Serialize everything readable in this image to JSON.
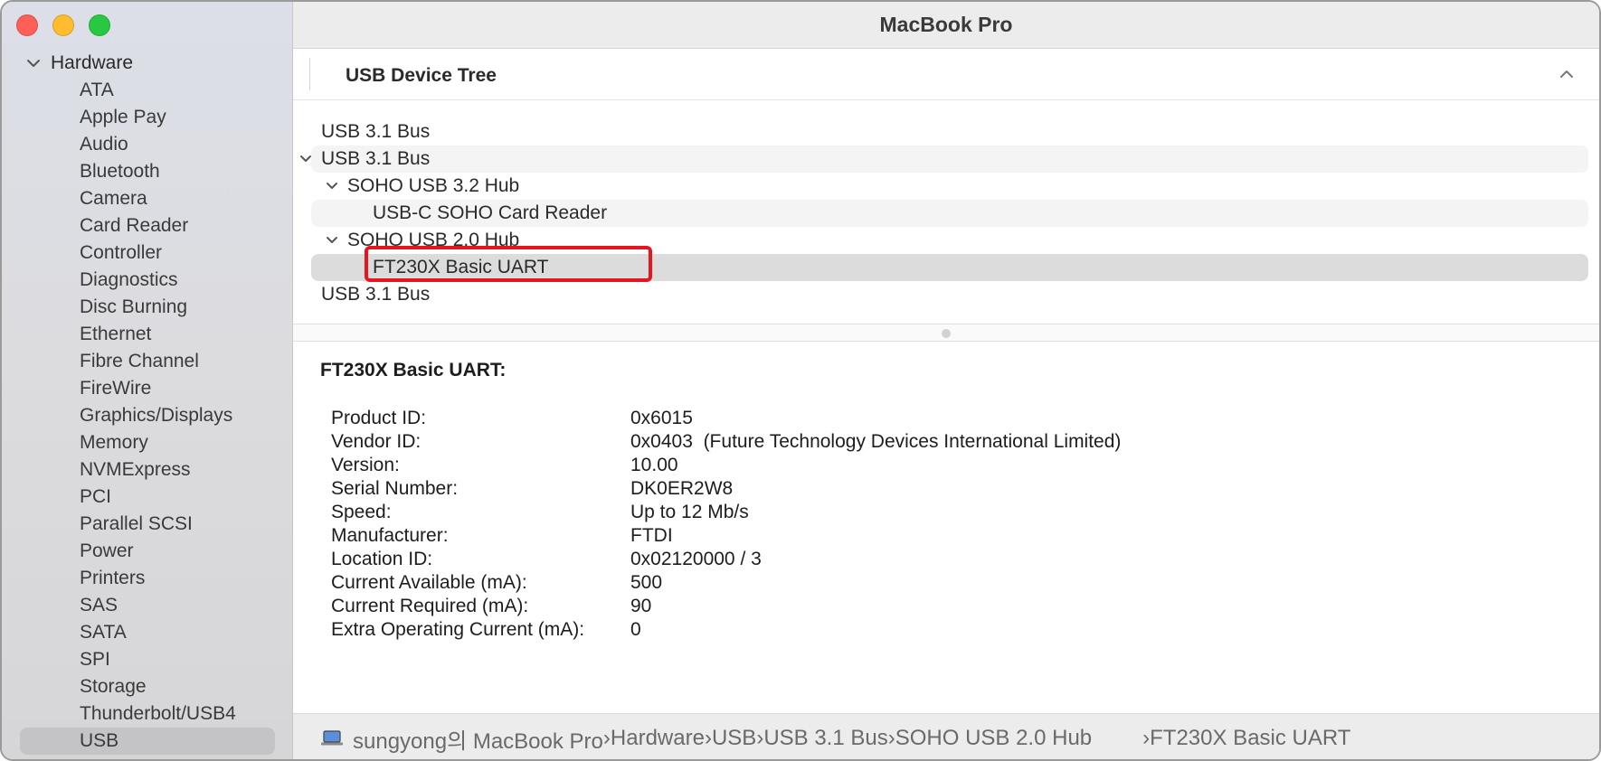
{
  "window": {
    "title": "MacBook Pro",
    "traffic_colors": {
      "close": "#fe5f57",
      "minimize": "#febc2e",
      "zoom": "#28c840"
    }
  },
  "sidebar": {
    "section_label": "Hardware",
    "items": [
      "ATA",
      "Apple Pay",
      "Audio",
      "Bluetooth",
      "Camera",
      "Card Reader",
      "Controller",
      "Diagnostics",
      "Disc Burning",
      "Ethernet",
      "Fibre Channel",
      "FireWire",
      "Graphics/Displays",
      "Memory",
      "NVMExpress",
      "PCI",
      "Parallel SCSI",
      "Power",
      "Printers",
      "SAS",
      "SATA",
      "SPI",
      "Storage",
      "Thunderbolt/USB4",
      "USB"
    ],
    "selected": "USB"
  },
  "tree": {
    "header": "USB Device Tree",
    "rows": [
      {
        "label": "USB 3.1 Bus",
        "level": 0,
        "expanded": false
      },
      {
        "label": "USB 3.1 Bus",
        "level": 0,
        "expanded": true
      },
      {
        "label": "SOHO USB 3.2 Hub",
        "level": 1,
        "expanded": true
      },
      {
        "label": "USB-C SOHO Card Reader",
        "level": 2,
        "expanded": false
      },
      {
        "label": "SOHO USB 2.0 Hub",
        "level": 1,
        "expanded": true
      },
      {
        "label": "FT230X Basic UART",
        "level": 2,
        "expanded": false,
        "selected": true
      },
      {
        "label": "USB 3.1 Bus",
        "level": 0,
        "expanded": false
      }
    ]
  },
  "detail": {
    "title": "FT230X Basic UART:",
    "properties": [
      {
        "key": "Product ID:",
        "value": "0x6015"
      },
      {
        "key": "Vendor ID:",
        "value": "0x0403  (Future Technology Devices International Limited)"
      },
      {
        "key": "Version:",
        "value": "10.00"
      },
      {
        "key": "Serial Number:",
        "value": "DK0ER2W8"
      },
      {
        "key": "Speed:",
        "value": "Up to 12 Mb/s"
      },
      {
        "key": "Manufacturer:",
        "value": "FTDI"
      },
      {
        "key": "Location ID:",
        "value": "0x02120000 / 3"
      },
      {
        "key": "Current Available (mA):",
        "value": "500"
      },
      {
        "key": "Current Required (mA):",
        "value": "90"
      },
      {
        "key": "Extra Operating Current (mA):",
        "value": "0"
      }
    ]
  },
  "breadcrumb": {
    "icon": "laptop-icon",
    "items": [
      "sungyong의 MacBook Pro",
      "Hardware",
      "USB",
      "USB 3.1 Bus",
      "SOHO USB 2.0 Hub",
      "FT230X Basic UART"
    ]
  },
  "highlight_color": "#e8141f"
}
